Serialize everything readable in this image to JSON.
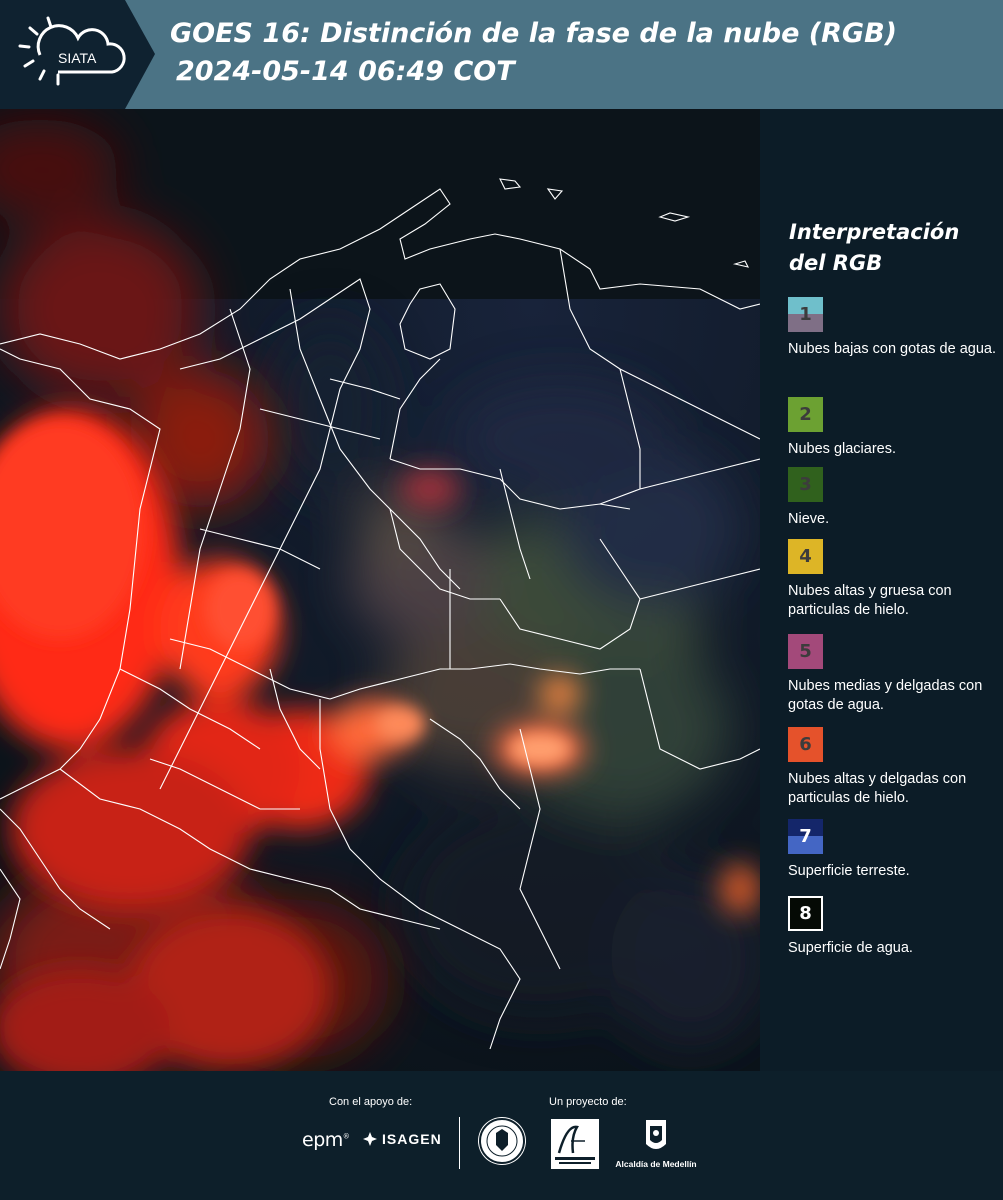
{
  "header": {
    "brand": "SIATA",
    "title_line1": "GOES 16: Distinción de la fase de la nube (RGB)",
    "title_line2": "2024-05-14 06:49 COT"
  },
  "legend": {
    "title_line1": "Interpretación",
    "title_line2": "del RGB",
    "items": [
      {
        "num": "1",
        "label": "Nubes bajas con gotas de agua.",
        "color_top": "#6fbfcb",
        "color_bottom": "#7f6f86"
      },
      {
        "num": "2",
        "label": "Nubes glaciares.",
        "color_top": "#6ca132",
        "color_bottom": "#6ca132"
      },
      {
        "num": "3",
        "label": "Nieve.",
        "color_top": "#30611d",
        "color_bottom": "#30611d"
      },
      {
        "num": "4",
        "label": "Nubes altas y gruesa con particulas de hielo.",
        "color_top": "#ddb526",
        "color_bottom": "#ddb526"
      },
      {
        "num": "5",
        "label": "Nubes medias y delgadas con gotas de agua.",
        "color_top": "#a3497a",
        "color_bottom": "#a3497a"
      },
      {
        "num": "6",
        "label": "Nubes altas y delgadas con particulas de hielo.",
        "color_top": "#e5522b",
        "color_bottom": "#e5522b"
      },
      {
        "num": "7",
        "label": "Superficie terreste.",
        "color_top": "#14266a",
        "color_bottom": "#4466c4"
      },
      {
        "num": "8",
        "label": "Superficie de agua.",
        "color_top": "#050a05",
        "color_bottom": "#050a05"
      }
    ]
  },
  "footer": {
    "support_label": "Con el apoyo de:",
    "project_label": "Un proyecto de:",
    "epm": "epm",
    "isagen": "ISAGEN",
    "alcaldia": "Alcaldía de Medellín"
  },
  "colors": {
    "header_bg": "#4b7385",
    "panel_bg": "#0c1c27",
    "cloud_red": "#ff2a14",
    "border_white": "#ffffff"
  }
}
